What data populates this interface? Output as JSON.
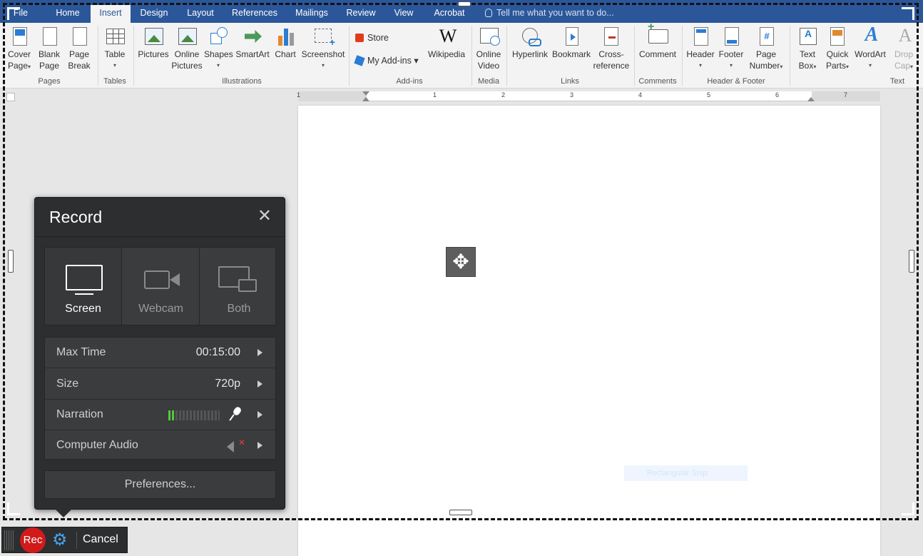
{
  "tabs": [
    {
      "label": "File",
      "active": false
    },
    {
      "label": "Home",
      "active": false
    },
    {
      "label": "Insert",
      "active": true
    },
    {
      "label": "Design",
      "active": false
    },
    {
      "label": "Layout",
      "active": false
    },
    {
      "label": "References",
      "active": false
    },
    {
      "label": "Mailings",
      "active": false
    },
    {
      "label": "Review",
      "active": false
    },
    {
      "label": "View",
      "active": false
    },
    {
      "label": "Acrobat",
      "active": false
    }
  ],
  "tell_me": "Tell me what you want to do...",
  "ribbon": {
    "cover_page": [
      "Cover",
      "Page"
    ],
    "blank_page": [
      "Blank",
      "Page"
    ],
    "page_break": [
      "Page",
      "Break"
    ],
    "table": "Table",
    "pictures": "Pictures",
    "online_pictures": [
      "Online",
      "Pictures"
    ],
    "shapes": "Shapes",
    "smartart": "SmartArt",
    "chart": "Chart",
    "screenshot": "Screenshot",
    "store": "Store",
    "my_addins": "My Add-ins",
    "wikipedia": "Wikipedia",
    "online_video": [
      "Online",
      "Video"
    ],
    "hyperlink": "Hyperlink",
    "bookmark": "Bookmark",
    "cross_reference": [
      "Cross-",
      "reference"
    ],
    "comment": "Comment",
    "header": "Header",
    "footer": "Footer",
    "page_number": [
      "Page",
      "Number"
    ],
    "text_box": [
      "Text",
      "Box"
    ],
    "quick_parts": [
      "Quick",
      "Parts"
    ],
    "wordart": "WordArt",
    "drop_cap": [
      "Drop",
      "Cap"
    ],
    "groups": {
      "pages": "Pages",
      "tables": "Tables",
      "illustrations": "Illustrations",
      "addins": "Add-ins",
      "media": "Media",
      "links": "Links",
      "comments": "Comments",
      "header_footer": "Header & Footer",
      "text": "Text"
    }
  },
  "ruler_marks": [
    "1",
    "1",
    "2",
    "3",
    "4",
    "5",
    "6",
    "7"
  ],
  "snip_label": "Rectangular Snip",
  "record": {
    "title": "Record",
    "close": "✕",
    "modes": {
      "screen": "Screen",
      "webcam": "Webcam",
      "both": "Both",
      "selected": "Screen"
    },
    "options": {
      "max_time": {
        "label": "Max Time",
        "value": "00:15:00"
      },
      "size": {
        "label": "Size",
        "value": "720p"
      },
      "narration": {
        "label": "Narration"
      },
      "computer_audio": {
        "label": "Computer Audio"
      }
    },
    "preferences": "Preferences..."
  },
  "controls": {
    "rec": "Rec",
    "cancel": "Cancel"
  },
  "colors": {
    "ribbon_blue": "#2b579a",
    "panel_dark": "#2c2e30",
    "rec_red": "#d11a1a",
    "meter_green": "#56c83c"
  }
}
